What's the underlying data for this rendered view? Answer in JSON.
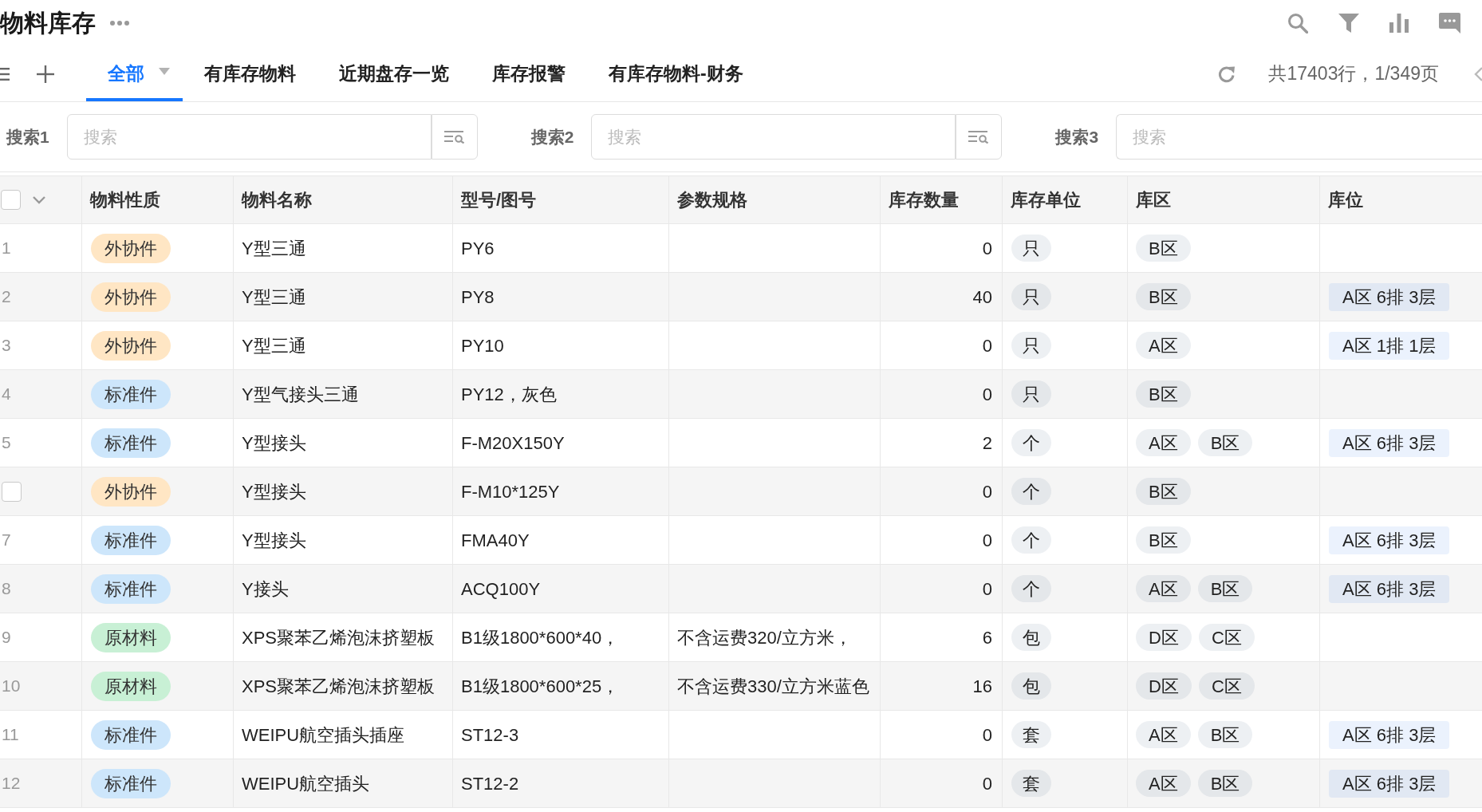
{
  "title": "物料库存",
  "tabs": [
    {
      "label": "全部",
      "selected": true,
      "dropdown": true
    },
    {
      "label": "有库存物料",
      "selected": false,
      "dropdown": false
    },
    {
      "label": "近期盘存一览",
      "selected": false,
      "dropdown": false
    },
    {
      "label": "库存报警",
      "selected": false,
      "dropdown": false
    },
    {
      "label": "有库存物料-财务",
      "selected": false,
      "dropdown": false
    }
  ],
  "page_info": "共17403行，1/349页",
  "searches": [
    {
      "label": "搜索1",
      "placeholder": "搜索",
      "button": true
    },
    {
      "label": "搜索2",
      "placeholder": "搜索",
      "button": true
    },
    {
      "label": "搜索3",
      "placeholder": "搜索",
      "button": false
    }
  ],
  "table": {
    "select_all": {
      "checked": false
    },
    "columns": [
      "物料性质",
      "物料名称",
      "型号/图号",
      "参数规格",
      "库存数量",
      "库存单位",
      "库区",
      "库位"
    ],
    "rows": [
      {
        "marker": {
          "kind": "number",
          "text": "1"
        },
        "category": {
          "label": "外协件",
          "color": "#ffe6c4"
        },
        "name": "Y型三通",
        "model": "PY6",
        "quantity": "0",
        "unit": "只",
        "zones": [
          "B区"
        ]
      },
      {
        "marker": {
          "kind": "number",
          "text": "2"
        },
        "category": {
          "label": "外协件",
          "color": "#ffe6c4"
        },
        "name": "Y型三通",
        "model": "PY8",
        "quantity": "40",
        "unit": "只",
        "zones": [
          "B区"
        ],
        "location": "A区 6排 3层"
      },
      {
        "marker": {
          "kind": "number",
          "text": "3"
        },
        "category": {
          "label": "外协件",
          "color": "#ffe6c4"
        },
        "name": "Y型三通",
        "model": "PY10",
        "quantity": "0",
        "unit": "只",
        "zones": [
          "A区"
        ],
        "location": "A区 1排 1层"
      },
      {
        "marker": {
          "kind": "number",
          "text": "4"
        },
        "category": {
          "label": "标准件",
          "color": "#cde6fb"
        },
        "name": "Y型气接头三通",
        "model": "PY12，灰色",
        "quantity": "0",
        "unit": "只",
        "zones": [
          "B区"
        ]
      },
      {
        "marker": {
          "kind": "number",
          "text": "5"
        },
        "category": {
          "label": "标准件",
          "color": "#cde6fb"
        },
        "name": "Y型接头",
        "model": "F-M20X150Y",
        "quantity": "2",
        "unit": "个",
        "zones": [
          "A区",
          "B区"
        ],
        "location": "A区 6排 3层"
      },
      {
        "marker": {
          "kind": "checkbox",
          "checked": false
        },
        "category": {
          "label": "外协件",
          "color": "#ffe6c4"
        },
        "name": "Y型接头",
        "model": "F-M10*125Y",
        "quantity": "0",
        "unit": "个",
        "zones": [
          "B区"
        ]
      },
      {
        "marker": {
          "kind": "number",
          "text": "7"
        },
        "category": {
          "label": "标准件",
          "color": "#cde6fb"
        },
        "name": "Y型接头",
        "model": "FMA40Y",
        "quantity": "0",
        "unit": "个",
        "zones": [
          "B区"
        ],
        "location": "A区 6排 3层"
      },
      {
        "marker": {
          "kind": "number",
          "text": "8"
        },
        "category": {
          "label": "标准件",
          "color": "#cde6fb"
        },
        "name": "Y接头",
        "model": "ACQ100Y",
        "quantity": "0",
        "unit": "个",
        "zones": [
          "A区",
          "B区"
        ],
        "location": "A区 6排 3层"
      },
      {
        "marker": {
          "kind": "number",
          "text": "9"
        },
        "category": {
          "label": "原材料",
          "color": "#c8f0d5"
        },
        "name": "XPS聚苯乙烯泡沫挤塑板",
        "model": "B1级1800*600*40，",
        "spec": "不含运费320/立方米，",
        "quantity": "6",
        "unit": "包",
        "zones": [
          "D区",
          "C区"
        ]
      },
      {
        "marker": {
          "kind": "number",
          "text": "10"
        },
        "category": {
          "label": "原材料",
          "color": "#c8f0d5"
        },
        "name": "XPS聚苯乙烯泡沫挤塑板",
        "model": "B1级1800*600*25，",
        "spec": "不含运费330/立方米蓝色",
        "quantity": "16",
        "unit": "包",
        "zones": [
          "D区",
          "C区"
        ]
      },
      {
        "marker": {
          "kind": "number",
          "text": "11"
        },
        "category": {
          "label": "标准件",
          "color": "#cde6fb"
        },
        "name": "WEIPU航空插头插座",
        "model": "ST12-3",
        "quantity": "0",
        "unit": "套",
        "zones": [
          "A区",
          "B区"
        ],
        "location": "A区 6排 3层"
      },
      {
        "marker": {
          "kind": "number",
          "text": "12"
        },
        "category": {
          "label": "标准件",
          "color": "#cde6fb"
        },
        "name": "WEIPU航空插头",
        "model": "ST12-2",
        "quantity": "0",
        "unit": "套",
        "zones": [
          "A区",
          "B区"
        ],
        "location": "A区 6排 3层"
      }
    ]
  }
}
